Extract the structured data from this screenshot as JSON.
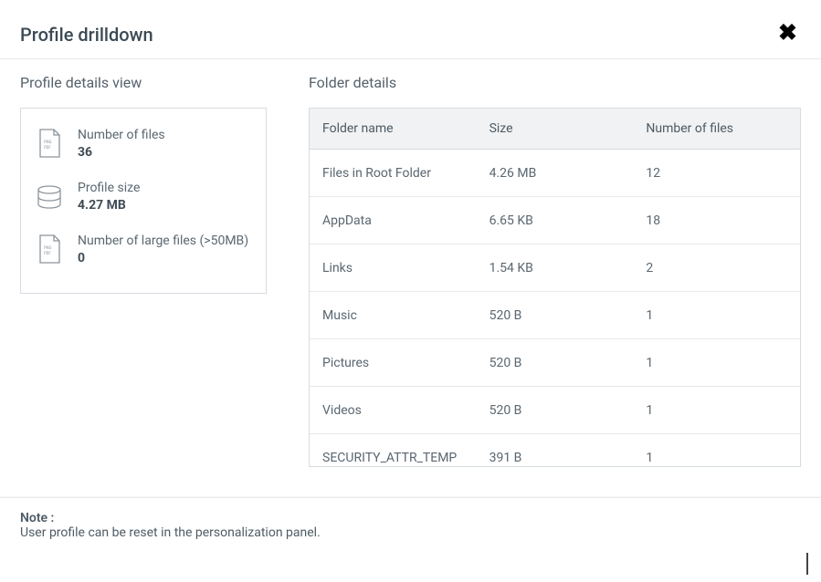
{
  "header": {
    "title": "Profile drilldown"
  },
  "profile_details": {
    "section_title": "Profile details view",
    "items": [
      {
        "icon": "files-icon",
        "label": "Number of files",
        "value": "36"
      },
      {
        "icon": "database-icon",
        "label": "Profile size",
        "value": "4.27 MB"
      },
      {
        "icon": "files-icon",
        "label": "Number of large files (>50MB)",
        "value": "0"
      }
    ]
  },
  "folder_details": {
    "section_title": "Folder details",
    "columns": {
      "name": "Folder name",
      "size": "Size",
      "count": "Number of files"
    },
    "rows": [
      {
        "name": "Files in Root Folder",
        "size": "4.26 MB",
        "count": "12"
      },
      {
        "name": "AppData",
        "size": "6.65 KB",
        "count": "18"
      },
      {
        "name": "Links",
        "size": "1.54 KB",
        "count": "2"
      },
      {
        "name": "Music",
        "size": "520 B",
        "count": "1"
      },
      {
        "name": "Pictures",
        "size": "520 B",
        "count": "1"
      },
      {
        "name": "Videos",
        "size": "520 B",
        "count": "1"
      },
      {
        "name": "SECURITY_ATTR_TEMP",
        "size": "391 B",
        "count": "1"
      }
    ]
  },
  "footer": {
    "note_label": "Note :",
    "note_text": "User profile can be reset in the personalization panel."
  }
}
